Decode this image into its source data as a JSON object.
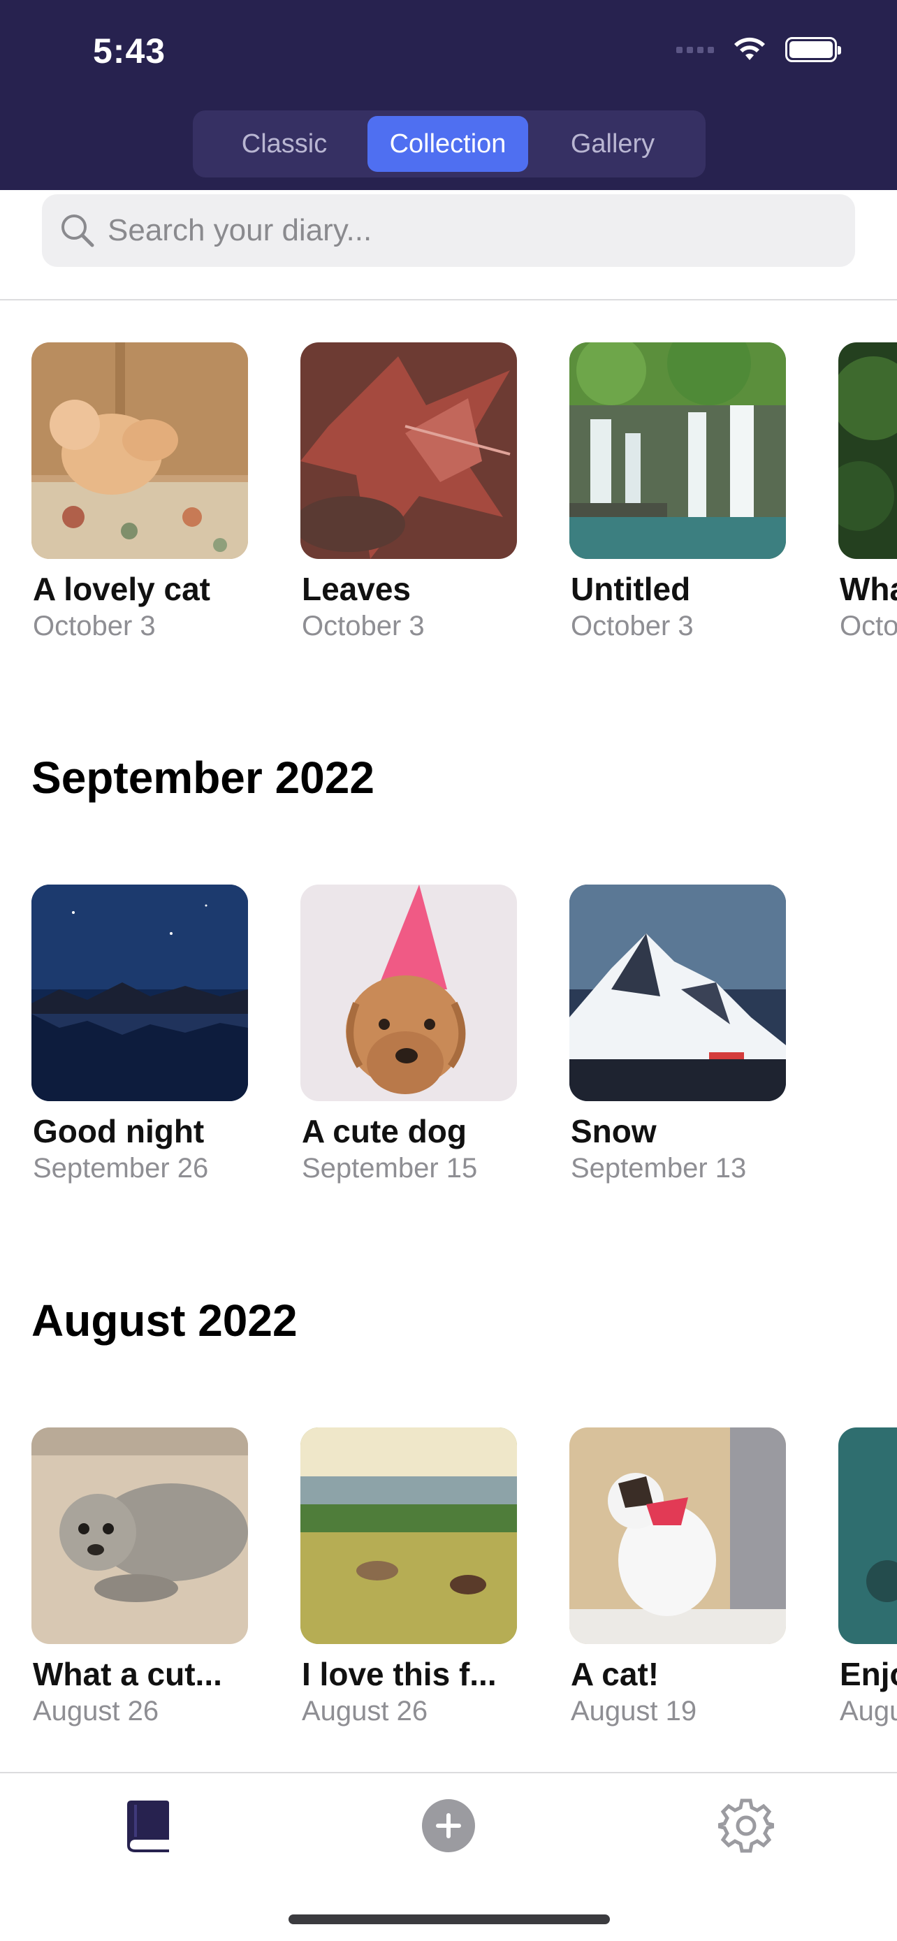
{
  "status_bar": {
    "time": "5:43"
  },
  "view_switcher": {
    "options": [
      "Classic",
      "Collection",
      "Gallery"
    ],
    "selected": "Collection"
  },
  "search": {
    "placeholder": "Search your diary..."
  },
  "sections": [
    {
      "title": "",
      "entries": [
        {
          "title": "A lovely cat",
          "date": "October 3",
          "image": "cat-on-cushion"
        },
        {
          "title": "Leaves",
          "date": "October 3",
          "image": "red-maple-leaves"
        },
        {
          "title": "Untitled",
          "date": "October 3",
          "image": "waterfall"
        },
        {
          "title": "Wha",
          "date": "Octo",
          "image": "forest-partial"
        }
      ]
    },
    {
      "title": "September 2022",
      "entries": [
        {
          "title": "Good night",
          "date": "September 26",
          "image": "night-lake-mountains"
        },
        {
          "title": "A cute dog",
          "date": "September 15",
          "image": "dog-party-hat"
        },
        {
          "title": "Snow",
          "date": "September 13",
          "image": "snowy-mountain-stars"
        }
      ]
    },
    {
      "title": "August 2022",
      "entries": [
        {
          "title": "What a cut...",
          "date": "August 26",
          "image": "seal-on-sand"
        },
        {
          "title": "I love this f...",
          "date": "August 26",
          "image": "cows-in-field"
        },
        {
          "title": "A cat!",
          "date": "August 19",
          "image": "white-cat-bandana"
        },
        {
          "title": "Enjo",
          "date": "Augu",
          "image": "sea-partial"
        }
      ]
    }
  ],
  "tabbar": {
    "items": [
      "diary-book-icon",
      "add-icon",
      "settings-gear-icon"
    ]
  },
  "colors": {
    "header": "#27224f",
    "accent": "#4f6ff1",
    "tab_active": "#27224f",
    "tab_inactive": "#9b9ba0"
  }
}
